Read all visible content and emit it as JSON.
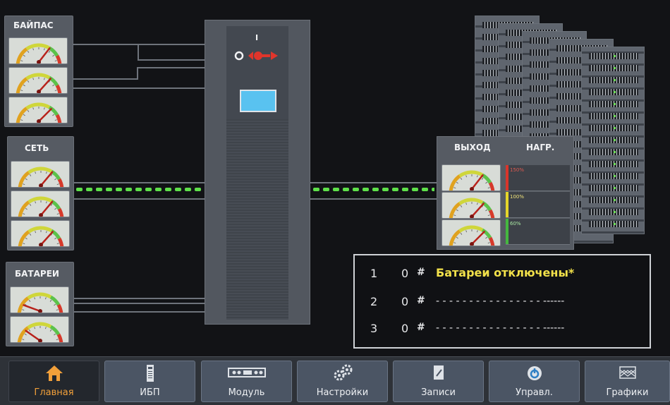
{
  "panels": {
    "bypass_title": "БАЙПАС",
    "mains_title": "СЕТЬ",
    "battery_title": "БАТАРЕИ",
    "output_title": "ВЫХОД",
    "load_title": "НАГР."
  },
  "load_levels": [
    {
      "label": "150%",
      "color": "#d9352b"
    },
    {
      "label": "100%",
      "color": "#e5d52a"
    },
    {
      "label": "60%",
      "color": "#45b83f"
    }
  ],
  "events": [
    {
      "index": "1",
      "count": "0",
      "hash": "#",
      "text": "Батареи отключены*",
      "color": "#f2e14a"
    },
    {
      "index": "2",
      "count": "0",
      "hash": "#",
      "text": "- - - - - - - - - - - - - - - - ------",
      "color": "#e7e8ea"
    },
    {
      "index": "3",
      "count": "0",
      "hash": "#",
      "text": "- - - - - - - - - - - - - - - - ------",
      "color": "#e7e8ea"
    }
  ],
  "nav": [
    {
      "label": "Главная",
      "icon": "home-icon"
    },
    {
      "label": "ИБП",
      "icon": "ups-icon"
    },
    {
      "label": "Модуль",
      "icon": "module-icon"
    },
    {
      "label": "Настройки",
      "icon": "settings-icon"
    },
    {
      "label": "Записи",
      "icon": "records-icon"
    },
    {
      "label": "Управл.",
      "icon": "power-icon"
    },
    {
      "label": "Графики",
      "icon": "charts-icon"
    }
  ],
  "ups": {
    "switch_mark": "I"
  },
  "colors": {
    "accent": "#f2a03a",
    "flow_green": "#5ee04a",
    "ups_screen": "#59c2f0"
  }
}
